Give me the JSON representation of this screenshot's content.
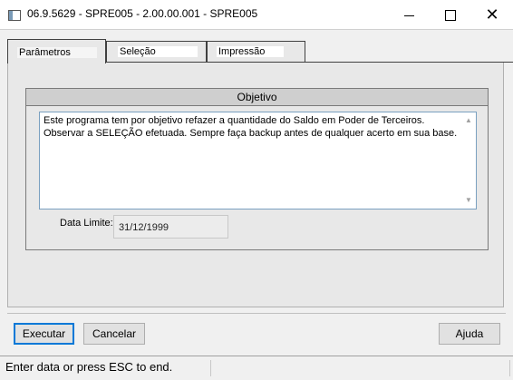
{
  "window": {
    "title": "06.9.5629 - SPRE005 - 2.00.00.001 - SPRE005",
    "icon": "app-window-icon",
    "controls": {
      "minimize": "minimize-icon",
      "maximize": "maximize-icon",
      "close": "close-icon"
    }
  },
  "tabs": [
    {
      "label": "Parâmetros",
      "active": true
    },
    {
      "label": "Seleção",
      "active": false
    },
    {
      "label": "Impressão",
      "active": false
    }
  ],
  "objetivo": {
    "header": "Objetivo",
    "text": "Este programa tem por objetivo refazer a quantidade do Saldo em Poder de Terceiros.\nObservar a SELEÇÃO efetuada. Sempre faça backup antes de qualquer acerto em sua base."
  },
  "data_limite": {
    "label": "Data Limite:",
    "value": "31/12/1999"
  },
  "buttons": {
    "executar": "Executar",
    "cancelar": "Cancelar",
    "ajuda": "Ajuda"
  },
  "status": {
    "text": "Enter data or press ESC to end."
  },
  "colors": {
    "focus_border": "#0078d7",
    "group_header_bg": "#cfcfcf",
    "textarea_border": "#7aa0c0"
  }
}
